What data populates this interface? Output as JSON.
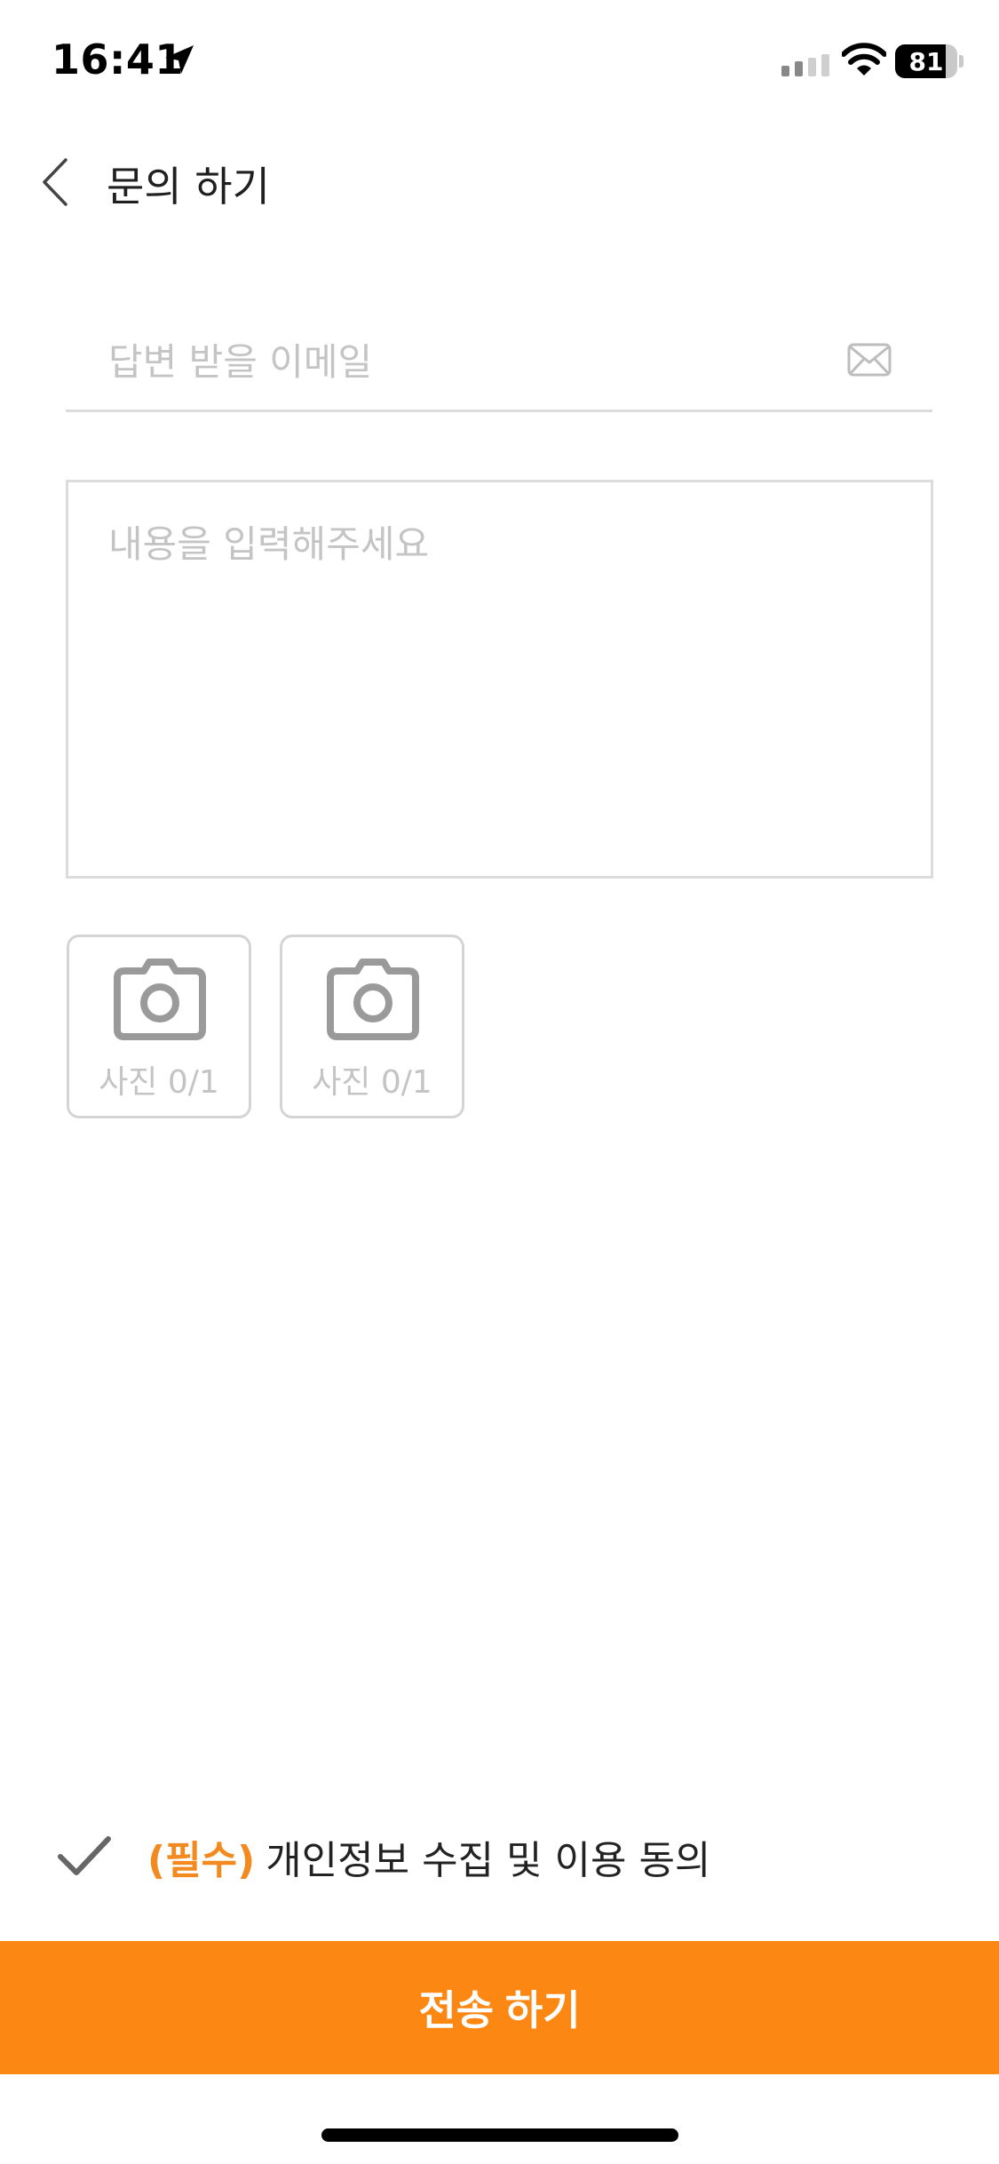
{
  "status_bar": {
    "time": "16:41",
    "battery_level": "81",
    "battery_percent": 81,
    "icons": [
      "location-arrow-icon",
      "cellular-signal-icon",
      "wifi-icon",
      "battery-icon"
    ]
  },
  "header": {
    "title": "문의 하기",
    "back_icon": "chevron-left-icon"
  },
  "form": {
    "email_placeholder": "답변 받을 이메일",
    "email_value": "",
    "email_icon": "mail-icon",
    "content_placeholder": "내용을 입력해주세요",
    "content_value": "",
    "photos": [
      {
        "icon": "camera-icon",
        "label": "사진 0/1"
      },
      {
        "icon": "camera-icon",
        "label": "사진 0/1"
      }
    ]
  },
  "consent": {
    "checked": true,
    "required_label": "(필수)",
    "text": "개인정보 수집 및 이용 동의"
  },
  "submit": {
    "label": "전송 하기"
  },
  "colors": {
    "accent": "#fd8713",
    "required_text": "#f38a1f",
    "border": "#dcdcdc",
    "placeholder": "#c4c4c4",
    "icon_gray": "#9a9a9a"
  }
}
